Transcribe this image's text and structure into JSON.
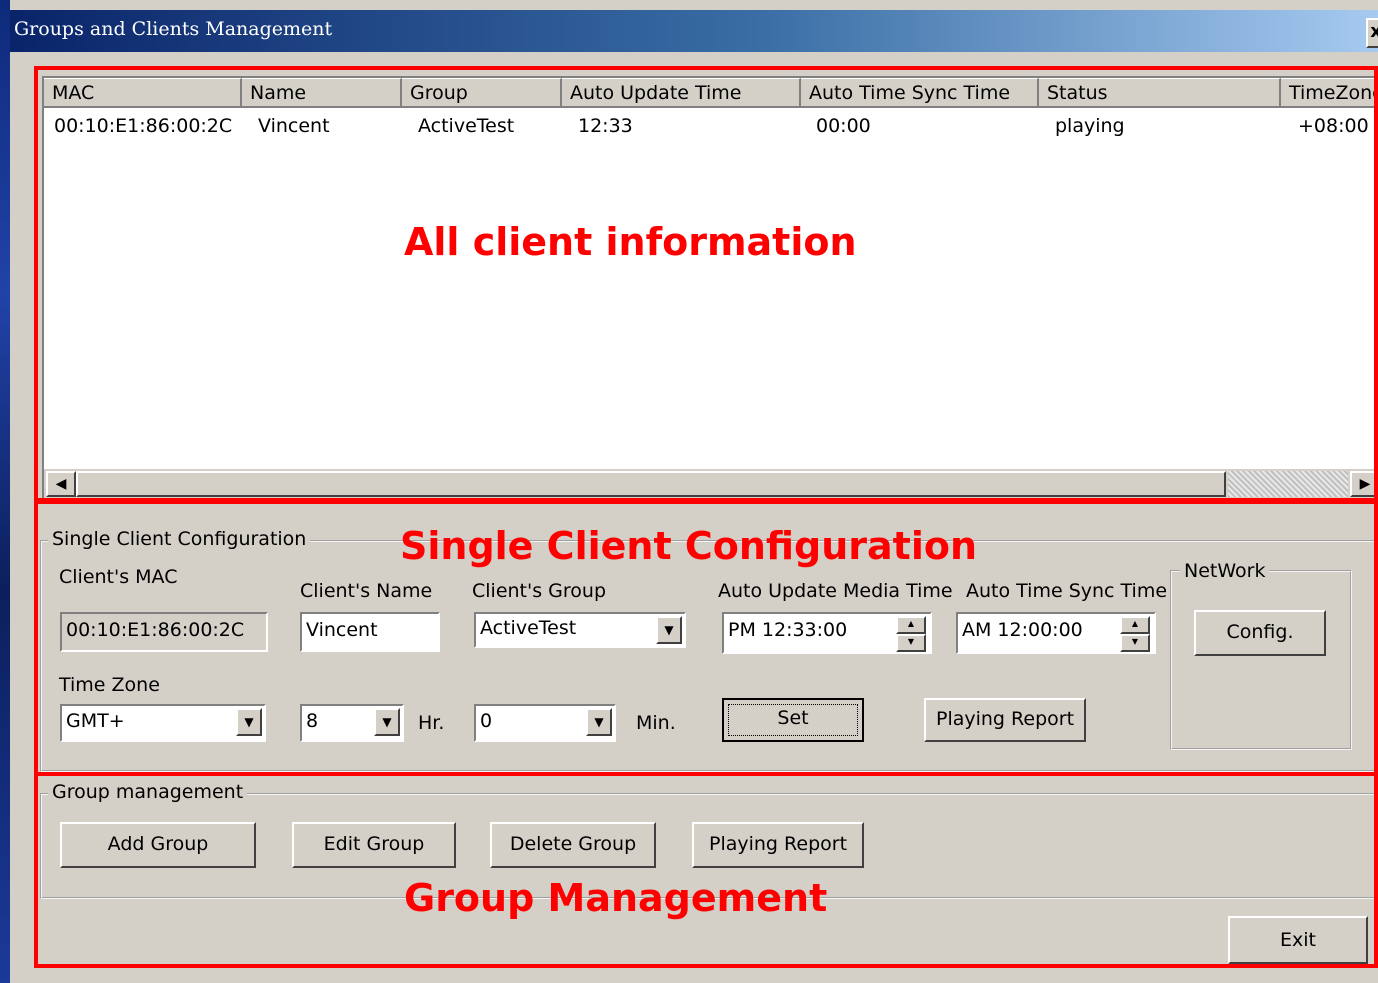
{
  "window": {
    "title": "Groups and Clients Management",
    "close_glyph": "x"
  },
  "client_list": {
    "columns": [
      "MAC",
      "Name",
      "Group",
      "Auto Update Time",
      "Auto Time Sync Time",
      "Status",
      "TimeZone"
    ],
    "rows": [
      [
        "00:10:E1:86:00:2C",
        "Vincent",
        "ActiveTest",
        "12:33",
        "00:00",
        "playing",
        "+08:00"
      ]
    ],
    "scroll_left_glyph": "◀",
    "scroll_right_glyph": "▶"
  },
  "single_config": {
    "title": "Single Client Configuration",
    "mac_label": "Client's MAC",
    "mac_value": "00:10:E1:86:00:2C",
    "name_label": "Client's Name",
    "name_value": "Vincent",
    "group_label": "Client's Group",
    "group_value": "ActiveTest",
    "update_label": "Auto Update Media Time",
    "update_value": "PM 12:33:00",
    "sync_label": "Auto Time Sync Time",
    "sync_value": "AM 12:00:00",
    "tz_label": "Time Zone",
    "tz_value": "GMT+",
    "hr_value": "8",
    "hr_label": "Hr.",
    "min_value": "0",
    "min_label": "Min.",
    "set_button": "Set",
    "playing_report_button": "Playing Report",
    "network": {
      "title": "NetWork",
      "config_button": "Config."
    }
  },
  "group_mgmt": {
    "title": "Group management",
    "add_button": "Add Group",
    "edit_button": "Edit Group",
    "delete_button": "Delete Group",
    "report_button": "Playing Report",
    "exit_button": "Exit"
  },
  "annotations": {
    "all_client": "All client information",
    "single_client": "Single Client Configuration",
    "group": "Group Management",
    "color": "#ff0000"
  },
  "dropdown_glyph": "▼",
  "spin_up_glyph": "▲",
  "spin_down_glyph": "▼"
}
